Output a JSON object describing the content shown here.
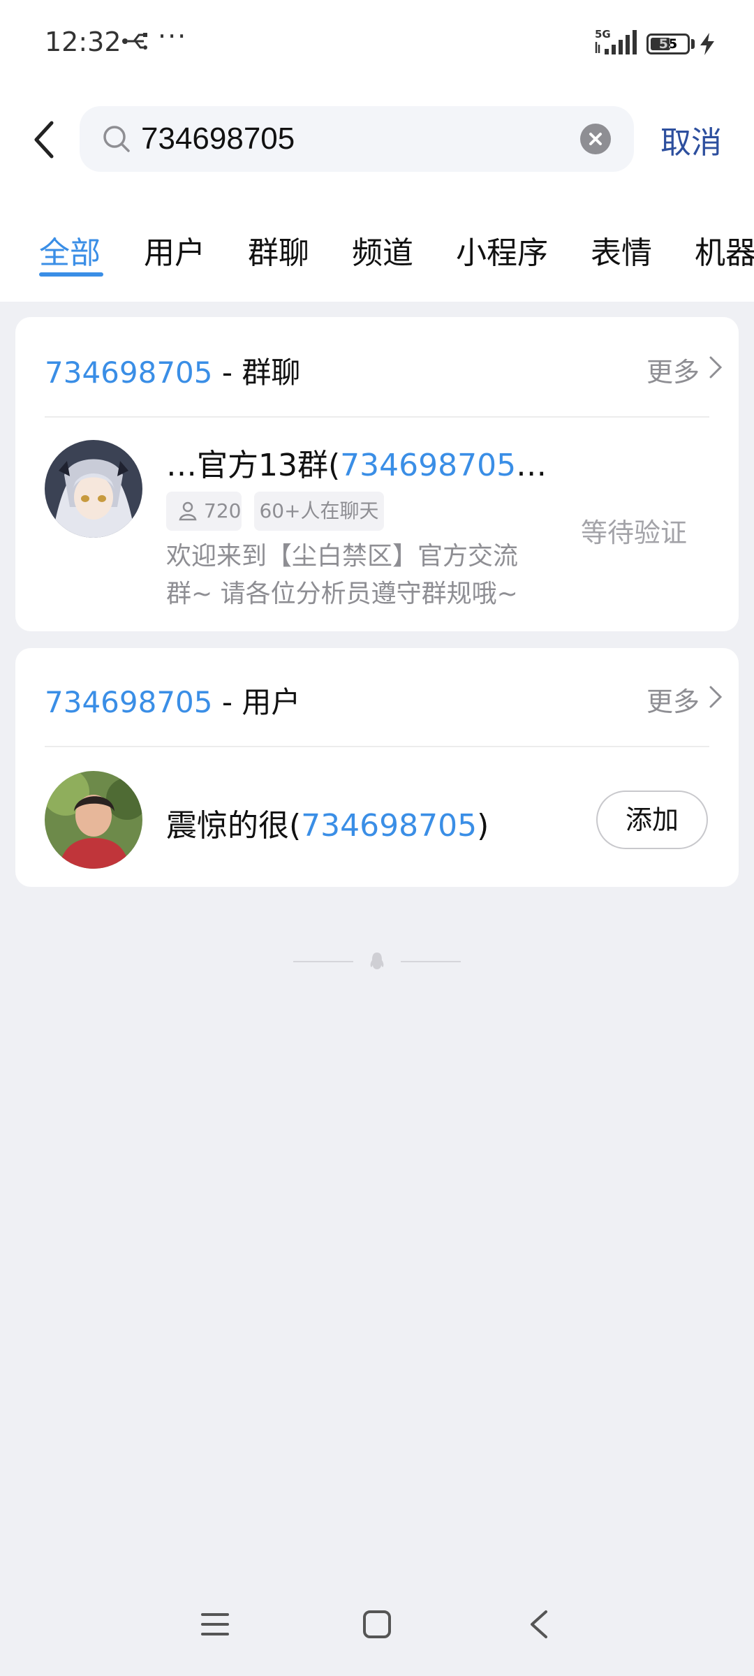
{
  "status_bar": {
    "time": "12:32",
    "more_dots": "···",
    "network": "5G",
    "battery_level": "55",
    "battery_percent": 55
  },
  "search": {
    "query": "734698705",
    "cancel_label": "取消"
  },
  "tabs": [
    {
      "label": "全部",
      "active": true
    },
    {
      "label": "用户",
      "active": false
    },
    {
      "label": "群聊",
      "active": false
    },
    {
      "label": "频道",
      "active": false
    },
    {
      "label": "小程序",
      "active": false
    },
    {
      "label": "表情",
      "active": false
    },
    {
      "label": "机器",
      "active": false
    }
  ],
  "group_section": {
    "query": "734698705",
    "suffix": " - 群聊",
    "more_label": "更多",
    "result": {
      "name_prefix": "…官方13群(",
      "name_highlight": "734698705",
      "name_suffix": "…",
      "member_count": "720",
      "active_tag": "60+人在聊天",
      "desc_line1": "欢迎来到【尘白禁区】官方交流",
      "desc_line2": "群~ 请各位分析员遵守群规哦~",
      "status": "等待验证"
    }
  },
  "user_section": {
    "query": "734698705",
    "suffix": " - 用户",
    "more_label": "更多",
    "result": {
      "name_prefix": "震惊的很(",
      "name_highlight": "734698705",
      "name_suffix": ")",
      "add_label": "添加"
    }
  },
  "colors": {
    "accent": "#3a8ee6",
    "cancel": "#2d4f9e",
    "background": "#eff0f4"
  }
}
